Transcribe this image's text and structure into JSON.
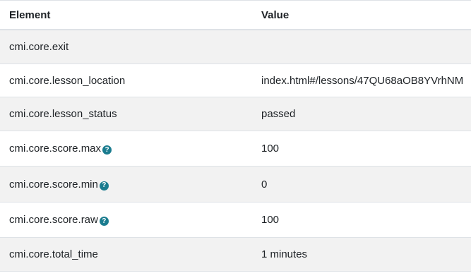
{
  "table": {
    "headers": {
      "element": "Element",
      "value": "Value"
    },
    "rows": [
      {
        "element": "cmi.core.exit",
        "value": "",
        "help": false
      },
      {
        "element": "cmi.core.lesson_location",
        "value": "index.html#/lessons/47QU68aOB8YVrhNM",
        "help": false
      },
      {
        "element": "cmi.core.lesson_status",
        "value": "passed",
        "help": false
      },
      {
        "element": "cmi.core.score.max",
        "value": "100",
        "help": true
      },
      {
        "element": "cmi.core.score.min",
        "value": "0",
        "help": true
      },
      {
        "element": "cmi.core.score.raw",
        "value": "100",
        "help": true
      },
      {
        "element": "cmi.core.total_time",
        "value": "1 minutes",
        "help": false
      }
    ]
  },
  "help_icon": {
    "name": "question-circle-icon",
    "glyph": "?",
    "color": "#1a7c8f"
  },
  "colors": {
    "stripe": "#f2f2f2",
    "border": "#dee2e6",
    "text": "#1d2125"
  }
}
